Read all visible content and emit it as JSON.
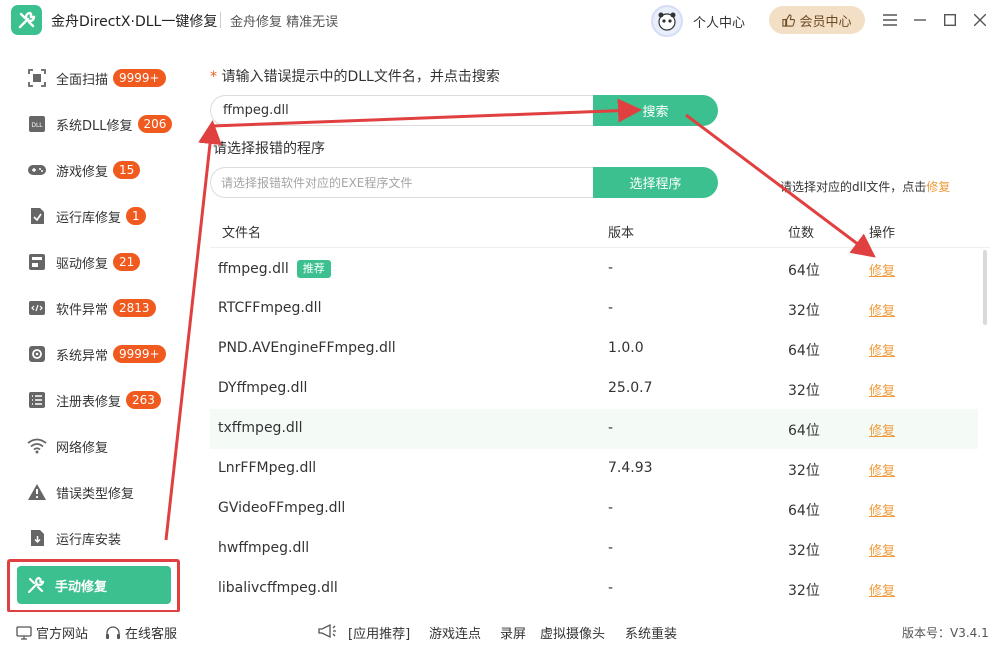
{
  "app": {
    "title": "金舟DirectX·DLL一键修复",
    "slogan": "金舟修复 精准无误",
    "user_center": "个人中心",
    "vip_label": "会员中心"
  },
  "sidebar": {
    "items": [
      {
        "label": "全面扫描",
        "badge": "9999+",
        "icon": "scan-icon"
      },
      {
        "label": "系统DLL修复",
        "badge": "206",
        "icon": "dll-icon"
      },
      {
        "label": "游戏修复",
        "badge": "15",
        "icon": "gamepad-icon"
      },
      {
        "label": "运行库修复",
        "badge": "1",
        "icon": "runtime-icon"
      },
      {
        "label": "驱动修复",
        "badge": "21",
        "icon": "driver-icon"
      },
      {
        "label": "软件异常",
        "badge": "2813",
        "icon": "code-icon"
      },
      {
        "label": "系统异常",
        "badge": "9999+",
        "icon": "gear-icon"
      },
      {
        "label": "注册表修复",
        "badge": "263",
        "icon": "registry-icon"
      },
      {
        "label": "网络修复",
        "badge": "",
        "icon": "wifi-icon"
      },
      {
        "label": "错误类型修复",
        "badge": "",
        "icon": "warning-icon"
      },
      {
        "label": "运行库安装",
        "badge": "",
        "icon": "install-icon"
      },
      {
        "label": "手动修复",
        "badge": "",
        "icon": "tools-icon"
      }
    ],
    "active": "手动修复"
  },
  "main": {
    "dll_prompt_star": "*",
    "dll_prompt": "请输入错误提示中的DLL文件名，并点击搜索",
    "search_value": "ffmpeg.dll",
    "search_button": "搜索",
    "program_label": "请选择报错的程序",
    "program_placeholder": "请选择报错软件对应的EXE程序文件",
    "program_button": "选择程序",
    "hint_text": "请选择对应的dll文件，点击",
    "hint_link": "修复"
  },
  "table": {
    "headers": [
      "文件名",
      "版本",
      "位数",
      "操作"
    ],
    "recommend_tag": "推荐",
    "rows": [
      {
        "name": "ffmpeg.dll",
        "version": "-",
        "bits": "64位",
        "action": "修复",
        "recommended": true
      },
      {
        "name": "RTCFFmpeg.dll",
        "version": "-",
        "bits": "32位",
        "action": "修复"
      },
      {
        "name": "PND.AVEngineFFmpeg.dll",
        "version": "1.0.0",
        "bits": "64位",
        "action": "修复"
      },
      {
        "name": "DYffmpeg.dll",
        "version": "25.0.7",
        "bits": "32位",
        "action": "修复"
      },
      {
        "name": "txffmpeg.dll",
        "version": "-",
        "bits": "64位",
        "action": "修复",
        "highlight": true
      },
      {
        "name": "LnrFFMpeg.dll",
        "version": "7.4.93",
        "bits": "32位",
        "action": "修复"
      },
      {
        "name": "GVideoFFmpeg.dll",
        "version": "-",
        "bits": "64位",
        "action": "修复"
      },
      {
        "name": "hwffmpeg.dll",
        "version": "-",
        "bits": "32位",
        "action": "修复"
      },
      {
        "name": "libalivcffmpeg.dll",
        "version": "-",
        "bits": "32位",
        "action": "修复"
      }
    ]
  },
  "footer": {
    "website": "官方网站",
    "support": "在线客服",
    "recommend": "[应用推荐]",
    "links": [
      "游戏连点",
      "录屏",
      "虚拟摄像头",
      "系统重装"
    ],
    "version": "版本号：V3.4.1"
  },
  "colors": {
    "accent": "#3cc08f",
    "badge": "#f05a1e",
    "link": "#f09a3a",
    "annotation": "#e04040"
  }
}
